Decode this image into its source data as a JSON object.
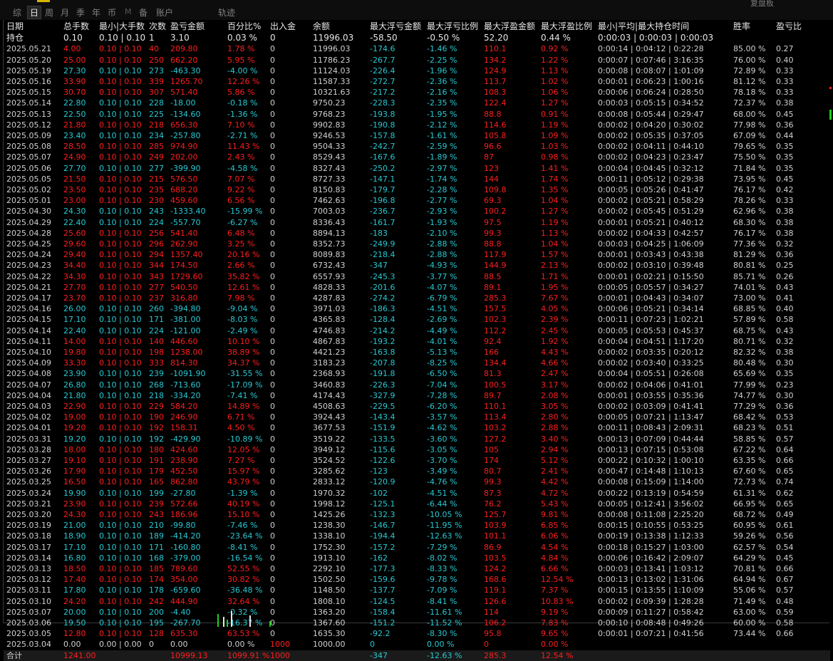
{
  "tabs": [
    "综",
    "日",
    "周",
    "月",
    "季",
    "年",
    "币",
    "M",
    "备",
    "账户",
    "轨迹"
  ],
  "active_tab": "日",
  "top_right_text": "复盘板",
  "headers": [
    "日期",
    "总手数",
    "最小|大手数",
    "次数",
    "盈亏金额",
    "百分比%",
    "出入金",
    "余额",
    "最大浮亏金额",
    "最大浮亏比例",
    "最大浮盈金额",
    "最大浮盈比例",
    "最小|平均|最大持仓时间",
    "胜率",
    "盈亏比"
  ],
  "position_row": [
    "持仓",
    "0.10",
    "0.10 | 0.10",
    "1",
    "3.10",
    "0.03 %",
    "0",
    "11996.03",
    "-58.50",
    "-0.50 %",
    "52.20",
    "0.44 %",
    "0:00:03 | 0:00:03 | 0:00:03",
    "",
    ""
  ],
  "rows": [
    [
      "2025.05.21",
      "4.00",
      "0.10 | 0.10",
      "40",
      "209.80",
      "1.78 %",
      "0",
      "11996.03",
      "-174.6",
      "-1.46 %",
      "110.1",
      "0.92 %",
      "0:00:14 | 0:04:12 | 0:22:28",
      "85.00 %",
      "0.27"
    ],
    [
      "2025.05.20",
      "25.00",
      "0.10 | 0.10",
      "250",
      "662.20",
      "5.95 %",
      "0",
      "11786.23",
      "-267.7",
      "-2.25 %",
      "134.2",
      "1.22 %",
      "0:00:07 | 0:07:46 | 3:16:35",
      "76.00 %",
      "0.40"
    ],
    [
      "2025.05.19",
      "27.30",
      "0.10 | 0.10",
      "273",
      "-463.30",
      "-4.00 %",
      "0",
      "11124.03",
      "-226.4",
      "-1.96 %",
      "124.9",
      "1.13 %",
      "0:00:08 | 0:08:07 | 1:01:09",
      "72.89 %",
      "0.33"
    ],
    [
      "2025.05.16",
      "33.90",
      "0.10 | 0.10",
      "339",
      "1265.70",
      "12.26 %",
      "0",
      "11587.33",
      "-272.7",
      "-2.36 %",
      "113.7",
      "1.02 %",
      "0:00:01 | 0:06:23 | 1:00:16",
      "81.12 %",
      "0.33"
    ],
    [
      "2025.05.15",
      "30.70",
      "0.10 | 0.10",
      "307",
      "571.40",
      "5.86 %",
      "0",
      "10321.63",
      "-217.2",
      "-2.16 %",
      "108.3",
      "1.06 %",
      "0:00:06 | 0:06:24 | 0:28:50",
      "78.18 %",
      "0.33"
    ],
    [
      "2025.05.14",
      "22.80",
      "0.10 | 0.10",
      "228",
      "-18.00",
      "-0.18 %",
      "0",
      "9750.23",
      "-228.3",
      "-2.35 %",
      "122.4",
      "1.27 %",
      "0:00:03 | 0:05:15 | 0:34:52",
      "72.37 %",
      "0.38"
    ],
    [
      "2025.05.13",
      "22.50",
      "0.10 | 0.10",
      "225",
      "-134.60",
      "-1.36 %",
      "0",
      "9768.23",
      "-193.8",
      "-1.95 %",
      "88.8",
      "0.91 %",
      "0:00:08 | 0:05:44 | 0:29:47",
      "68.00 %",
      "0.45"
    ],
    [
      "2025.05.12",
      "21.80",
      "0.10 | 0.10",
      "218",
      "656.30",
      "7.10 %",
      "0",
      "9902.83",
      "-190.8",
      "-2.12 %",
      "114.6",
      "1.19 %",
      "0:00:02 | 0:04:20 | 0:30:02",
      "77.98 %",
      "0.36"
    ],
    [
      "2025.05.09",
      "23.40",
      "0.10 | 0.10",
      "234",
      "-257.80",
      "-2.71 %",
      "0",
      "9246.53",
      "-157.8",
      "-1.61 %",
      "105.8",
      "1.09 %",
      "0:00:02 | 0:05:35 | 0:37:05",
      "67.09 %",
      "0.44"
    ],
    [
      "2025.05.08",
      "28.50",
      "0.10 | 0.10",
      "285",
      "974.90",
      "11.43 %",
      "0",
      "9504.33",
      "-242.7",
      "-2.59 %",
      "96.6",
      "1.03 %",
      "0:00:02 | 0:04:11 | 0:44:10",
      "79.65 %",
      "0.35"
    ],
    [
      "2025.05.07",
      "24.90",
      "0.10 | 0.10",
      "249",
      "202.00",
      "2.43 %",
      "0",
      "8529.43",
      "-167.6",
      "-1.89 %",
      "87",
      "0.98 %",
      "0:00:02 | 0:04:23 | 0:23:47",
      "75.50 %",
      "0.35"
    ],
    [
      "2025.05.06",
      "27.70",
      "0.10 | 0.10",
      "277",
      "-399.90",
      "-4.58 %",
      "0",
      "8327.43",
      "-250.2",
      "-2.97 %",
      "123",
      "1.41 %",
      "0:00:04 | 0:04:45 | 0:32:12",
      "71.84 %",
      "0.35"
    ],
    [
      "2025.05.05",
      "21.50",
      "0.10 | 0.10",
      "215",
      "576.50",
      "7.07 %",
      "0",
      "8727.33",
      "-147.1",
      "-1.74 %",
      "144",
      "1.74 %",
      "0:00:11 | 0:05:12 | 0:29:38",
      "73.95 %",
      "0.45"
    ],
    [
      "2025.05.02",
      "23.50",
      "0.10 | 0.10",
      "235",
      "688.20",
      "9.22 %",
      "0",
      "8150.83",
      "-179.7",
      "-2.28 %",
      "109.8",
      "1.35 %",
      "0:00:05 | 0:05:26 | 0:41:47",
      "76.17 %",
      "0.42"
    ],
    [
      "2025.05.01",
      "23.00",
      "0.10 | 0.10",
      "230",
      "459.60",
      "6.56 %",
      "0",
      "7462.63",
      "-196.8",
      "-2.77 %",
      "69.3",
      "1.04 %",
      "0:00:02 | 0:05:21 | 0:58:29",
      "78.26 %",
      "0.33"
    ],
    [
      "2025.04.30",
      "24.30",
      "0.10 | 0.10",
      "243",
      "-1333.40",
      "-15.99 %",
      "0",
      "7003.03",
      "-236.7",
      "-2.93 %",
      "100.2",
      "1.27 %",
      "0:00:02 | 0:05:45 | 0:51:29",
      "62.96 %",
      "0.38"
    ],
    [
      "2025.04.29",
      "22.40",
      "0.10 | 0.10",
      "224",
      "-557.70",
      "-6.27 %",
      "0",
      "8336.43",
      "-161.7",
      "-1.93 %",
      "97.5",
      "1.19 %",
      "0:00:01 | 0:05:21 | 0:40:12",
      "68.30 %",
      "0.38"
    ],
    [
      "2025.04.28",
      "25.60",
      "0.10 | 0.10",
      "256",
      "541.40",
      "6.48 %",
      "0",
      "8894.13",
      "-183",
      "-2.10 %",
      "99.3",
      "1.13 %",
      "0:00:02 | 0:04:33 | 0:42:57",
      "76.17 %",
      "0.38"
    ],
    [
      "2025.04.25",
      "29.60",
      "0.10 | 0.10",
      "296",
      "262.90",
      "3.25 %",
      "0",
      "8352.73",
      "-249.9",
      "-2.88 %",
      "88.8",
      "1.04 %",
      "0:00:03 | 0:04:25 | 1:06:09",
      "77.36 %",
      "0.32"
    ],
    [
      "2025.04.24",
      "29.40",
      "0.10 | 0.10",
      "294",
      "1357.40",
      "20.16 %",
      "0",
      "8089.83",
      "-218.4",
      "-2.88 %",
      "117.9",
      "1.57 %",
      "0:00:01 | 0:03:43 | 0:43:38",
      "81.29 %",
      "0.36"
    ],
    [
      "2025.04.23",
      "34.40",
      "0.10 | 0.10",
      "344",
      "174.50",
      "2.66 %",
      "0",
      "6732.43",
      "-347",
      "-4.93 %",
      "144.9",
      "2.13 %",
      "0:00:02 | 0:03:10 | 0:39:48",
      "80.81 %",
      "0.25"
    ],
    [
      "2025.04.22",
      "34.30",
      "0.10 | 0.10",
      "343",
      "1729.60",
      "35.82 %",
      "0",
      "6557.93",
      "-245.3",
      "-3.77 %",
      "88.5",
      "1.71 %",
      "0:00:01 | 0:02:21 | 0:15:50",
      "85.71 %",
      "0.26"
    ],
    [
      "2025.04.21",
      "27.70",
      "0.10 | 0.10",
      "277",
      "540.50",
      "12.61 %",
      "0",
      "4828.33",
      "-201.6",
      "-4.07 %",
      "89.1",
      "1.95 %",
      "0:00:05 | 0:05:57 | 0:34:27",
      "74.01 %",
      "0.43"
    ],
    [
      "2025.04.17",
      "23.70",
      "0.10 | 0.10",
      "237",
      "316.80",
      "7.98 %",
      "0",
      "4287.83",
      "-274.2",
      "-6.79 %",
      "285.3",
      "7.67 %",
      "0:00:01 | 0:04:43 | 0:34:07",
      "73.00 %",
      "0.41"
    ],
    [
      "2025.04.16",
      "26.00",
      "0.10 | 0.10",
      "260",
      "-394.80",
      "-9.04 %",
      "0",
      "3971.03",
      "-186.3",
      "-4.51 %",
      "157.5",
      "4.05 %",
      "0:00:06 | 0:05:21 | 0:34:14",
      "68.85 %",
      "0.40"
    ],
    [
      "2025.04.15",
      "17.10",
      "0.10 | 0.10",
      "171",
      "-381.00",
      "-8.03 %",
      "0",
      "4365.83",
      "-128.4",
      "-2.69 %",
      "102.3",
      "2.39 %",
      "0:00:11 | 0:07:23 | 1:02:21",
      "57.89 %",
      "0.58"
    ],
    [
      "2025.04.14",
      "22.40",
      "0.10 | 0.10",
      "224",
      "-121.00",
      "-2.49 %",
      "0",
      "4746.83",
      "-214.2",
      "-4.49 %",
      "112.2",
      "2.45 %",
      "0:00:05 | 0:05:53 | 0:45:37",
      "68.75 %",
      "0.43"
    ],
    [
      "2025.04.11",
      "14.00",
      "0.10 | 0.10",
      "140",
      "446.60",
      "10.10 %",
      "0",
      "4867.83",
      "-193.2",
      "-4.01 %",
      "92.4",
      "1.92 %",
      "0:00:04 | 0:04:51 | 1:17:20",
      "80.71 %",
      "0.32"
    ],
    [
      "2025.04.10",
      "19.80",
      "0.10 | 0.10",
      "198",
      "1238.00",
      "38.89 %",
      "0",
      "4421.23",
      "-163.8",
      "-5.13 %",
      "166",
      "4.43 %",
      "0:00:02 | 0:03:35 | 0:20:12",
      "82.32 %",
      "0.38"
    ],
    [
      "2025.04.09",
      "33.30",
      "0.10 | 0.10",
      "333",
      "814.30",
      "34.37 %",
      "0",
      "3183.23",
      "-207.8",
      "-8.25 %",
      "134.4",
      "4.66 %",
      "0:00:02 | 0:03:40 | 0:33:25",
      "80.48 %",
      "0.30"
    ],
    [
      "2025.04.08",
      "23.90",
      "0.10 | 0.10",
      "239",
      "-1091.90",
      "-31.55 %",
      "0",
      "2368.93",
      "-191.8",
      "-6.50 %",
      "81.3",
      "2.47 %",
      "0:00:04 | 0:05:51 | 0:26:08",
      "65.69 %",
      "0.35"
    ],
    [
      "2025.04.07",
      "26.80",
      "0.10 | 0.10",
      "268",
      "-713.60",
      "-17.09 %",
      "0",
      "3460.83",
      "-226.3",
      "-7.04 %",
      "100.5",
      "3.17 %",
      "0:00:02 | 0:04:06 | 0:41:01",
      "77.99 %",
      "0.23"
    ],
    [
      "2025.04.04",
      "21.80",
      "0.10 | 0.10",
      "218",
      "-334.20",
      "-7.41 %",
      "0",
      "4174.43",
      "-327.9",
      "-7.28 %",
      "89.7",
      "2.08 %",
      "0:00:01 | 0:03:55 | 0:35:36",
      "74.77 %",
      "0.30"
    ],
    [
      "2025.04.03",
      "22.90",
      "0.10 | 0.10",
      "229",
      "584.20",
      "14.89 %",
      "0",
      "4508.63",
      "-229.5",
      "-6.20 %",
      "110.1",
      "3.05 %",
      "0:00:02 | 0:03:09 | 0:41:41",
      "77.29 %",
      "0.36"
    ],
    [
      "2025.04.02",
      "19.00",
      "0.10 | 0.10",
      "190",
      "246.90",
      "6.71 %",
      "0",
      "3924.43",
      "-143.4",
      "-3.57 %",
      "113.4",
      "2.80 %",
      "0:00:05 | 0:07:21 | 1:13:47",
      "68.42 %",
      "0.53"
    ],
    [
      "2025.04.01",
      "19.20",
      "0.10 | 0.10",
      "192",
      "158.31",
      "4.50 %",
      "0",
      "3677.53",
      "-151.9",
      "-4.62 %",
      "103.2",
      "2.88 %",
      "0:00:11 | 0:08:43 | 2:09:31",
      "68.23 %",
      "0.51"
    ],
    [
      "2025.03.31",
      "19.20",
      "0.10 | 0.10",
      "192",
      "-429.90",
      "-10.89 %",
      "0",
      "3519.22",
      "-133.5",
      "-3.60 %",
      "127.2",
      "3.40 %",
      "0:00:13 | 0:07:09 | 0:44:44",
      "58.85 %",
      "0.57"
    ],
    [
      "2025.03.28",
      "18.00",
      "0.10 | 0.10",
      "180",
      "424.60",
      "12.05 %",
      "0",
      "3949.12",
      "-115.6",
      "-3.05 %",
      "105",
      "2.94 %",
      "0:00:13 | 0:07:15 | 0:53:08",
      "67.22 %",
      "0.64"
    ],
    [
      "2025.03.27",
      "19.10",
      "0.10 | 0.10",
      "191",
      "238.90",
      "7.27 %",
      "0",
      "3524.52",
      "-122.6",
      "-3.70 %",
      "174",
      "5.12 %",
      "0:00:22 | 0:10:32 | 1:00:10",
      "63.35 %",
      "0.66"
    ],
    [
      "2025.03.26",
      "17.90",
      "0.10 | 0.10",
      "179",
      "452.50",
      "15.97 %",
      "0",
      "3285.62",
      "-123",
      "-3.49 %",
      "80.7",
      "2.41 %",
      "0:00:47 | 0:14:48 | 1:10:13",
      "67.60 %",
      "0.65"
    ],
    [
      "2025.03.25",
      "16.50",
      "0.10 | 0.10",
      "165",
      "862.80",
      "43.79 %",
      "0",
      "2833.12",
      "-120.9",
      "-4.76 %",
      "99.3",
      "4.42 %",
      "0:00:08 | 0:15:09 | 1:14:00",
      "72.73 %",
      "0.74"
    ],
    [
      "2025.03.24",
      "19.90",
      "0.10 | 0.10",
      "199",
      "-27.80",
      "-1.39 %",
      "0",
      "1970.32",
      "-102",
      "-4.51 %",
      "87.3",
      "4.72 %",
      "0:00:22 | 0:13:19 | 0:54:59",
      "61.31 %",
      "0.62"
    ],
    [
      "2025.03.21",
      "23.90",
      "0.10 | 0.10",
      "239",
      "572.66",
      "40.19 %",
      "0",
      "1998.12",
      "-125.1",
      "-6.44 %",
      "76.2",
      "5.43 %",
      "0:00:05 | 0:12:41 | 3:56:02",
      "66.95 %",
      "0.65"
    ],
    [
      "2025.03.20",
      "24.30",
      "0.10 | 0.10",
      "243",
      "186.96",
      "15.10 %",
      "0",
      "1425.26",
      "-132.3",
      "-10.05 %",
      "125.7",
      "9.81 %",
      "0:00:08 | 0:11:08 | 2:25:20",
      "68.72 %",
      "0.49"
    ],
    [
      "2025.03.19",
      "21.00",
      "0.10 | 0.10",
      "210",
      "-99.80",
      "-7.46 %",
      "0",
      "1238.30",
      "-146.7",
      "-11.95 %",
      "103.9",
      "6.85 %",
      "0:00:15 | 0:10:55 | 0:53:25",
      "60.95 %",
      "0.61"
    ],
    [
      "2025.03.18",
      "18.90",
      "0.10 | 0.10",
      "189",
      "-414.20",
      "-23.64 %",
      "0",
      "1338.10",
      "-194.4",
      "-12.63 %",
      "101.1",
      "6.06 %",
      "0:00:19 | 0:13:38 | 1:12:33",
      "59.26 %",
      "0.56"
    ],
    [
      "2025.03.17",
      "17.10",
      "0.10 | 0.10",
      "171",
      "-160.80",
      "-8.41 %",
      "0",
      "1752.30",
      "-157.2",
      "-7.29 %",
      "86.9",
      "4.54 %",
      "0:00:18 | 0:15:27 | 1:03:00",
      "62.57 %",
      "0.54"
    ],
    [
      "2025.03.14",
      "16.80",
      "0.10 | 0.10",
      "168",
      "-379.00",
      "-16.54 %",
      "0",
      "1913.10",
      "-162",
      "-8.02 %",
      "103.5",
      "4.84 %",
      "0:00:06 | 0:16:42 | 2:09:07",
      "64.29 %",
      "0.45"
    ],
    [
      "2025.03.13",
      "18.50",
      "0.10 | 0.10",
      "185",
      "789.60",
      "52.55 %",
      "0",
      "2292.10",
      "-177.3",
      "-8.33 %",
      "124.2",
      "6.66 %",
      "0:00:03 | 0:13:41 | 1:03:12",
      "70.81 %",
      "0.66"
    ],
    [
      "2025.03.12",
      "17.40",
      "0.10 | 0.10",
      "174",
      "354.00",
      "30.82 %",
      "0",
      "1502.50",
      "-159.6",
      "-9.78 %",
      "168.6",
      "12.54 %",
      "0:00:13 | 0:13:02 | 1:31:06",
      "64.94 %",
      "0.67"
    ],
    [
      "2025.03.11",
      "17.80",
      "0.10 | 0.10",
      "178",
      "-659.60",
      "-36.48 %",
      "0",
      "1148.50",
      "-137.7",
      "-7.09 %",
      "119.1",
      "7.37 %",
      "0:00:15 | 0:13:55 | 1:10:09",
      "55.06 %",
      "0.57"
    ],
    [
      "2025.03.10",
      "24.20",
      "0.10 | 0.10",
      "242",
      "444.90",
      "32.64 %",
      "0",
      "1808.10",
      "-124.5",
      "-8.41 %",
      "126.6",
      "10.83 %",
      "0:00:02 | 0:09:39 | 1:28:28",
      "71.49 %",
      "0.48"
    ],
    [
      "2025.03.07",
      "20.00",
      "0.10 | 0.10",
      "200",
      "-4.40",
      "-0.32 %",
      "0",
      "1363.20",
      "-158.4",
      "-11.61 %",
      "114",
      "9.19 %",
      "0:00:09 | 0:11:27 | 0:58:42",
      "63.00 %",
      "0.59"
    ],
    [
      "2025.03.06",
      "19.50",
      "0.10 | 0.10",
      "195",
      "-267.70",
      "-16.37 %",
      "0",
      "1367.60",
      "-151.2",
      "-11.52 %",
      "106.2",
      "7.83 %",
      "0:00:10 | 0:08:48 | 0:49:26",
      "60.00 %",
      "0.58"
    ],
    [
      "2025.03.05",
      "12.80",
      "0.10 | 0.10",
      "128",
      "635.30",
      "63.53 %",
      "0",
      "1635.30",
      "-92.2",
      "-8.30 %",
      "95.8",
      "9.65 %",
      "0:00:01 | 0:07:21 | 0:41:56",
      "73.44 %",
      "0.66"
    ],
    [
      "2025.03.04",
      "0.00",
      "0.00 | 0.00",
      "0",
      "0.00",
      "0.00 %",
      "1000",
      "1000.00",
      "0",
      "0.00 %",
      "0",
      "0.00 %",
      "",
      "",
      ""
    ]
  ],
  "total_row": [
    "合计",
    "1241.00",
    "",
    "",
    "10999.13",
    "1099.91 %",
    "1000",
    "",
    "-347",
    "-12.63 %",
    "285.3",
    "12.54 %",
    "",
    "",
    ""
  ],
  "colors": {
    "profit": "#ff1e1e",
    "loss": "#29c8d2",
    "neutral": "#d0d0d0",
    "background": "#000000"
  }
}
